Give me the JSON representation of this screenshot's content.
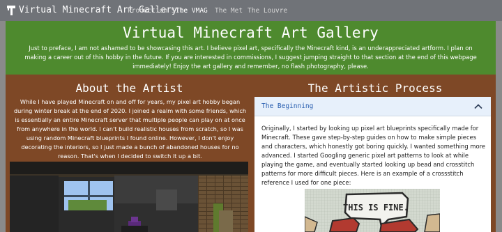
{
  "navbar": {
    "brand": "Virtual Minecraft Art Gallery",
    "links": [
      "Production Site",
      "The VMAG",
      "The Met",
      "The Louvre"
    ],
    "active_link": "The VMAG"
  },
  "hero": {
    "title": "Virtual Minecraft Art Gallery",
    "text": "Just to preface, I am not ashamed to be showcasing this art. I believe pixel art, specifically the Minecraft kind, is an underappreciated artform. I plan on making a career out of this hobby in the future. If you are interested in commissions, I suggest jumping straight to that section at the end of this webpage immediately! Enjoy the art gallery and remember, no flash photography, please."
  },
  "about": {
    "title": "About the Artist",
    "text": "While I have played Minecraft on and off for years, my pixel art hobby began during winter break at the end of 2020. I joined a realm with some friends, which is essentially an entire Minecraft server that multiple people can play on at once from anywhere in the world. I can't build realistic houses from scratch, so I was using random Minecraft blueprints I found online. However, I don't enjoy decorating the interiors, so I just made a bunch of abandoned houses for no reason. That's when I decided to switch it up a bit."
  },
  "process": {
    "title": "The Artistic Process",
    "accordion": {
      "header": "The Beginning",
      "body": "Originally, I started by looking up pixel art blueprints specifically made for Minecraft. These gave step-by-step guides on how to make simple pieces and characters, which honestly got boring quickly. I wanted something more advanced. I started Googling generic pixel art patterns to look at while playing the game, and eventually started looking up bead and crosstitch patterns for more difficult pieces. Here is an example of a crossstitch reference I used for one piece:",
      "image_caption": "THIS IS FINE."
    }
  },
  "colors": {
    "navbar": "#707378",
    "hero": "#4e8a2e",
    "main": "#7e4826",
    "accordion_header": "#e7f0fb",
    "accordion_label": "#2a5fb0"
  },
  "icons": {
    "brand": "brand-logo-icon",
    "chevron": "chevron-up-icon"
  }
}
